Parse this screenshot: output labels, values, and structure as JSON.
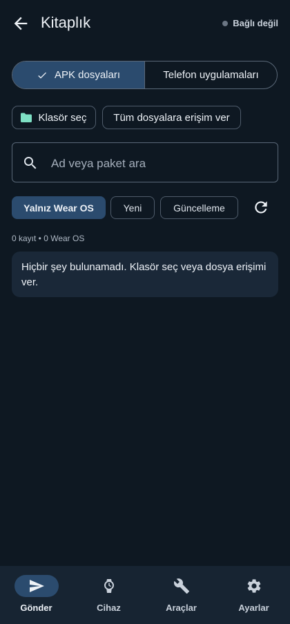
{
  "header": {
    "title": "Kitaplık",
    "status": "Bağlı değil"
  },
  "tabs": [
    {
      "label": "APK dosyaları",
      "active": true
    },
    {
      "label": "Telefon uygulamaları",
      "active": false
    }
  ],
  "actions": {
    "choose_folder": "Klasör seç",
    "grant_access": "Tüm dosyalara erişim ver"
  },
  "search": {
    "placeholder": "Ad veya paket ara",
    "value": ""
  },
  "filters": [
    {
      "label": "Yalnız Wear OS",
      "selected": true
    },
    {
      "label": "Yeni",
      "selected": false
    },
    {
      "label": "Güncelleme",
      "selected": false
    }
  ],
  "counts": "0 kayıt • 0 Wear OS",
  "empty_message": "Hiçbir şey bulunamadı. Klasör seç veya dosya erişimi ver.",
  "nav": [
    {
      "label": "Gönder",
      "icon": "send-icon",
      "active": true
    },
    {
      "label": "Cihaz",
      "icon": "watch-icon",
      "active": false
    },
    {
      "label": "Araçlar",
      "icon": "wrench-icon",
      "active": false
    },
    {
      "label": "Ayarlar",
      "icon": "gear-icon",
      "active": false
    }
  ],
  "colors": {
    "background": "#0e1822",
    "accent": "#2b4b6e",
    "folder_icon": "#7ee0c4",
    "nav_background": "#172432"
  }
}
